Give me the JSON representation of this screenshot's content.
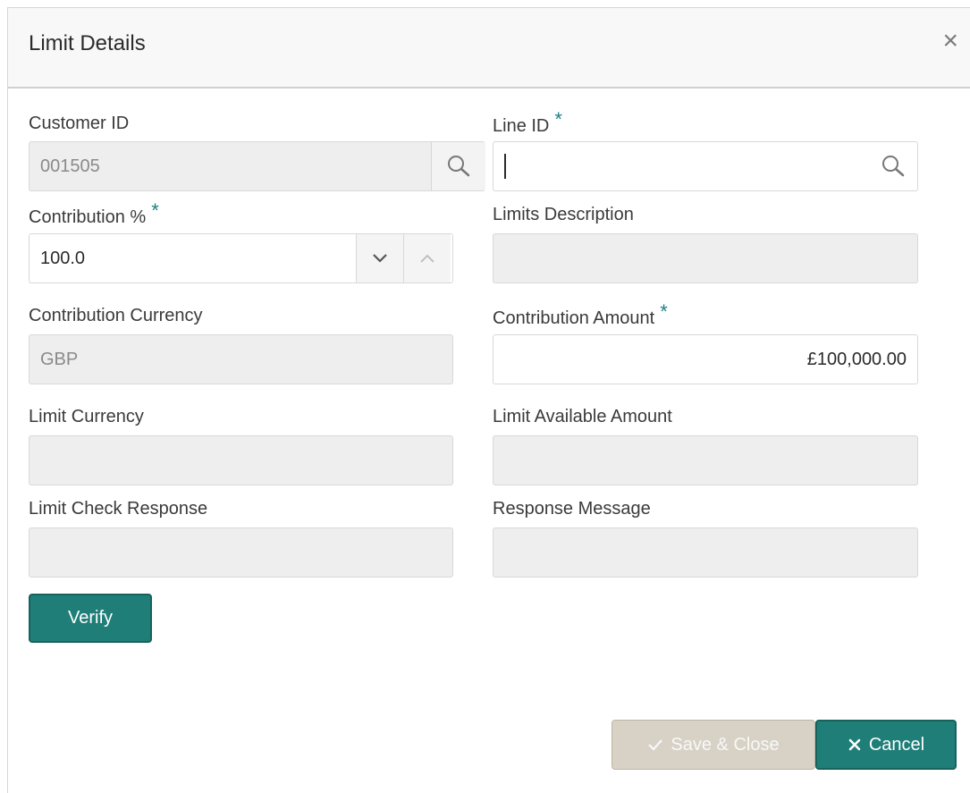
{
  "dialog": {
    "title": "Limit Details",
    "close_icon": "close-icon"
  },
  "form": {
    "customer_id": {
      "label": "Customer ID",
      "value": "001505",
      "icon": "search-icon"
    },
    "line_id": {
      "label": "Line ID",
      "required": "*",
      "value": "",
      "icon": "search-icon"
    },
    "contribution_pct": {
      "label": "Contribution %",
      "required": "*",
      "value": "100.0",
      "down_icon": "chevron-down-icon",
      "up_icon": "chevron-up-icon"
    },
    "limits_description": {
      "label": "Limits Description",
      "value": ""
    },
    "contribution_currency": {
      "label": "Contribution Currency",
      "value": "GBP"
    },
    "contribution_amount": {
      "label": "Contribution Amount",
      "required": "*",
      "value": "£100,000.00"
    },
    "limit_currency": {
      "label": "Limit Currency",
      "value": ""
    },
    "limit_available_amount": {
      "label": "Limit Available Amount",
      "value": ""
    },
    "limit_check_response": {
      "label": "Limit Check Response",
      "value": ""
    },
    "response_message": {
      "label": "Response Message",
      "value": ""
    }
  },
  "actions": {
    "verify_label": "Verify",
    "save_label": "Save & Close",
    "save_icon": "check-icon",
    "cancel_label": "Cancel",
    "cancel_icon": "close-icon"
  },
  "colors": {
    "primary": "#1f7e78",
    "required": "#1d7f86",
    "disabled_button": "#d8d2c6",
    "readonly_field": "#eeeeee"
  }
}
